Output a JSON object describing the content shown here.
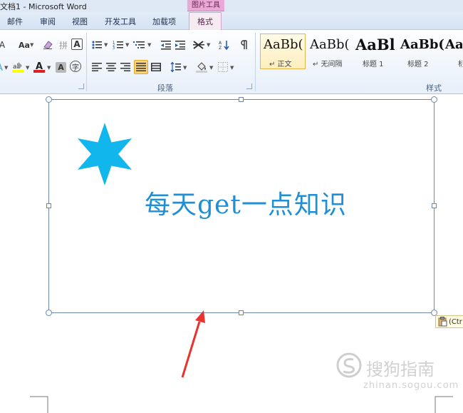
{
  "window": {
    "title": "文档1 - Microsoft Word",
    "context_group": "图片工具"
  },
  "tabs": [
    {
      "label": "邮件"
    },
    {
      "label": "审阅"
    },
    {
      "label": "视图"
    },
    {
      "label": "开发工具"
    },
    {
      "label": "加载项"
    },
    {
      "label": "格式",
      "active": true
    }
  ],
  "ribbon": {
    "font_group": {
      "grow_font": "A",
      "change_case": "Aa",
      "pinyin": "拼",
      "char_border": "A",
      "font_color_glyph": "A",
      "char_shading": "A",
      "enclose": "字"
    },
    "paragraph_group": {
      "label": "段落"
    },
    "styles_group": {
      "label": "样式",
      "styles": [
        {
          "sample": "AaBb(",
          "name": "↵ 正文",
          "active": true
        },
        {
          "sample": "AaBb(",
          "name": "↵ 无间隔"
        },
        {
          "sample": "AaBl",
          "name": "标题 1",
          "bold": true
        },
        {
          "sample": "AaBb(",
          "name": "标题 2",
          "bold": true
        },
        {
          "sample": "Aal",
          "name": "标",
          "bold": true
        }
      ]
    }
  },
  "document": {
    "canvas_text": "每天get一点知识",
    "star_color": "#11b6ec",
    "text_color": "#1f8fd6",
    "arrow_color": "#e8332f",
    "paste_options": "(Ctr",
    "watermark_name": "搜狗指南",
    "watermark_url": "zhinan.sogou.com"
  }
}
